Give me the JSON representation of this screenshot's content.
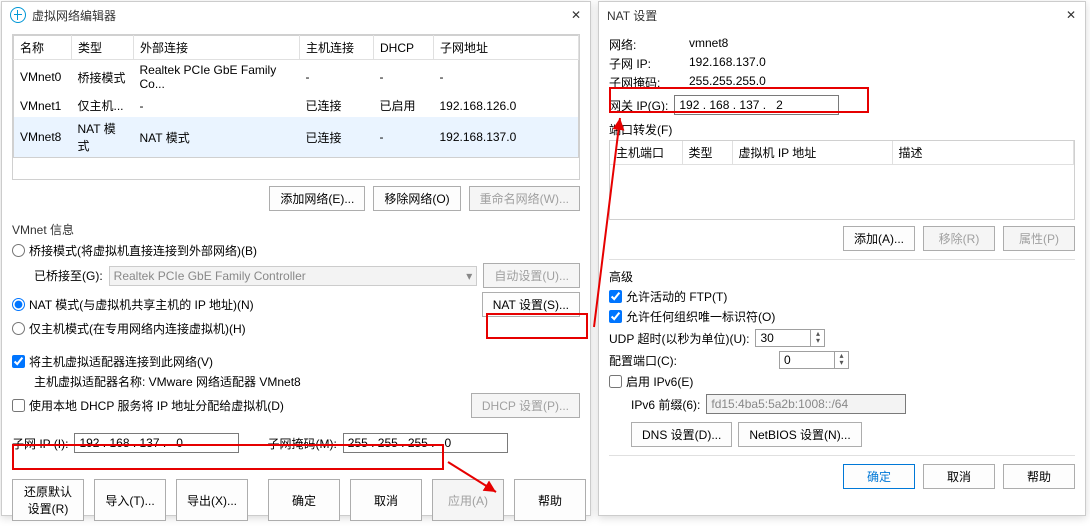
{
  "left": {
    "title": "虚拟网络编辑器",
    "columns": [
      "名称",
      "类型",
      "外部连接",
      "主机连接",
      "DHCP",
      "子网地址"
    ],
    "rows": [
      {
        "name": "VMnet0",
        "type": "桥接模式",
        "ext": "Realtek PCIe GbE Family Co...",
        "host": "-",
        "dhcp": "-",
        "subnet": "-"
      },
      {
        "name": "VMnet1",
        "type": "仅主机...",
        "ext": "-",
        "host": "已连接",
        "dhcp": "已启用",
        "subnet": "192.168.126.0"
      },
      {
        "name": "VMnet8",
        "type": "NAT 模式",
        "ext": "NAT 模式",
        "host": "已连接",
        "dhcp": "-",
        "subnet": "192.168.137.0"
      }
    ],
    "add_btn": "添加网络(E)...",
    "remove_btn": "移除网络(O)",
    "rename_btn": "重命名网络(W)...",
    "vmnet_info": "VMnet 信息",
    "bridge_radio": "桥接模式(将虚拟机直接连接到外部网络)(B)",
    "bridged_to_label": "已桥接至(G):",
    "bridged_to_value": "Realtek PCIe GbE Family Controller",
    "auto_settings": "自动设置(U)...",
    "nat_radio": "NAT 模式(与虚拟机共享主机的 IP 地址)(N)",
    "nat_settings": "NAT 设置(S)...",
    "hostonly_radio": "仅主机模式(在专用网络内连接虚拟机)(H)",
    "host_adapter_check": "将主机虚拟适配器连接到此网络(V)",
    "host_adapter_name_label": "主机虚拟适配器名称: ",
    "host_adapter_name_value": "VMware 网络适配器 VMnet8",
    "dhcp_check": "使用本地 DHCP 服务将 IP 地址分配给虚拟机(D)",
    "dhcp_settings": "DHCP 设置(P)...",
    "subnet_ip_label": "子网 IP (I):",
    "subnet_ip_value": "192 . 168 . 137 .   0",
    "subnet_mask_label": "子网掩码(M):",
    "subnet_mask_value": "255 . 255 . 255 .   0",
    "restore": "还原默认设置(R)",
    "import": "导入(T)...",
    "export": "导出(X)...",
    "ok": "确定",
    "cancel": "取消",
    "apply": "应用(A)",
    "help": "帮助"
  },
  "right": {
    "title": "NAT 设置",
    "network_label": "网络:",
    "network_value": "vmnet8",
    "subnet_ip_label": "子网 IP:",
    "subnet_ip_value": "192.168.137.0",
    "subnet_mask_label": "子网掩码:",
    "subnet_mask_value": "255.255.255.0",
    "gateway_label": "网关 IP(G):",
    "gateway_value": "192 . 168 . 137 .   2",
    "port_forward": "端口转发(F)",
    "pf_columns": [
      "主机端口",
      "类型",
      "虚拟机 IP 地址",
      "描述"
    ],
    "add": "添加(A)...",
    "remove": "移除(R)",
    "props": "属性(P)",
    "advanced": "高级",
    "allow_ftp": "允许活动的 FTP(T)",
    "allow_any_oui": "允许任何组织唯一标识符(O)",
    "udp_timeout_label": "UDP 超时(以秒为单位)(U):",
    "udp_timeout_value": "30",
    "config_port_label": "配置端口(C):",
    "config_port_value": "0",
    "enable_ipv6": "启用 IPv6(E)",
    "ipv6_prefix_label": "IPv6 前缀(6):",
    "ipv6_prefix_value": "fd15:4ba5:5a2b:1008::/64",
    "dns_settings": "DNS 设置(D)...",
    "netbios_settings": "NetBIOS 设置(N)...",
    "ok": "确定",
    "cancel": "取消",
    "help": "帮助"
  }
}
